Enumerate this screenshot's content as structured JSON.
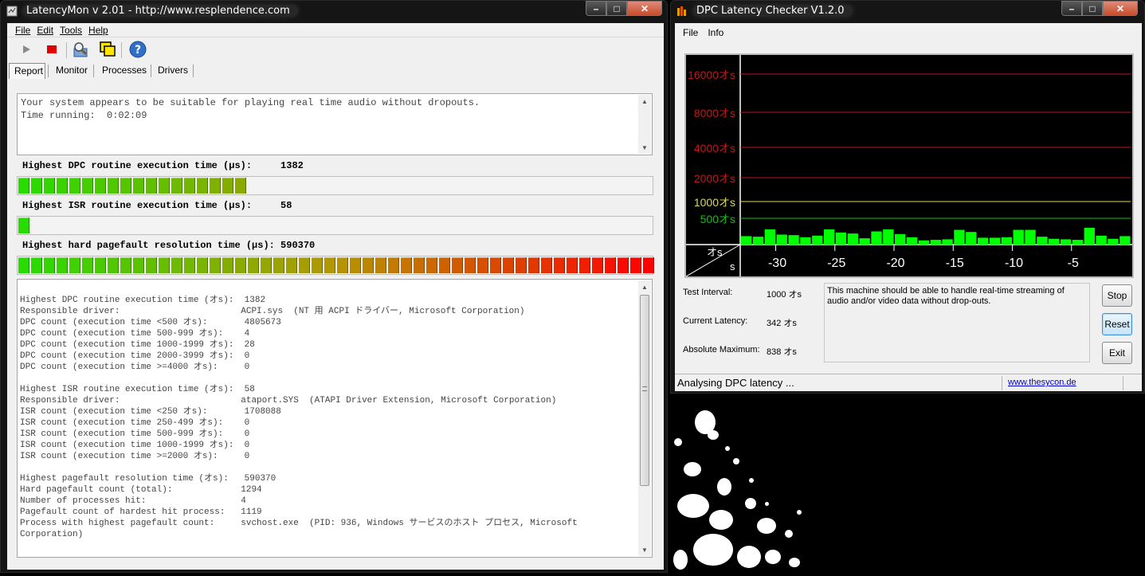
{
  "latencymon": {
    "title": "LatencyMon v 2.01 - http://www.resplendence.com",
    "menu": [
      "File",
      "Edit",
      "Tools",
      "Help"
    ],
    "tabs": [
      "Report",
      "Monitor",
      "Processes",
      "Drivers"
    ],
    "status_text": "Your system appears to be suitable for playing real time audio without dropouts.",
    "time_running": "Time running:  0:02:09",
    "dpc_label": "Highest DPC routine execution time (µs):     1382",
    "isr_label": "Highest ISR routine execution time (µs):     58",
    "pf_label": "Highest hard pagefault resolution time (µs): 590370",
    "dpc_level": 0.36,
    "isr_level": 0.02,
    "pf_level": 1.0,
    "report_lines": [
      "Highest DPC routine execution time (オs):  1382",
      "Responsible driver:                       ACPI.sys  (NT 用 ACPI ドライバー, Microsoft Corporation)",
      "DPC count (execution time <500 オs):       4805673",
      "DPC count (execution time 500-999 オs):    4",
      "DPC count (execution time 1000-1999 オs):  28",
      "DPC count (execution time 2000-3999 オs):  0",
      "DPC count (execution time >=4000 オs):     0",
      "",
      "Highest ISR routine execution time (オs):  58",
      "Responsible driver:                       ataport.SYS  (ATAPI Driver Extension, Microsoft Corporation)",
      "ISR count (execution time <250 オs):       1708088",
      "ISR count (execution time 250-499 オs):    0",
      "ISR count (execution time 500-999 オs):    0",
      "ISR count (execution time 1000-1999 オs):  0",
      "ISR count (execution time >=2000 オs):     0",
      "",
      "Highest pagefault resolution time (オs):   590370",
      "Hard pagefault count (total):             1294",
      "Number of processes hit:                  4",
      "Pagefault count of hardest hit process:   1119",
      "Process with highest pagefault count:     svchost.exe  (PID: 936, Windows サービスのホスト プロセス, Microsoft",
      "Corporation)"
    ]
  },
  "dpc_checker": {
    "title": "DPC Latency Checker V1.2.0",
    "menu": [
      "File",
      "Info"
    ],
    "test_interval_label": "Test Interval:",
    "test_interval_value": "1000 オs",
    "current_latency_label": "Current Latency:",
    "current_latency_value": "342 オs",
    "absolute_max_label": "Absolute Maximum:",
    "absolute_max_value": "838 オs",
    "message": "This machine should be able to handle real-time streaming of audio and/or video data without drop-outs.",
    "buttons": {
      "stop": "Stop",
      "reset": "Reset",
      "exit": "Exit"
    },
    "status": "Analysing DPC latency ...",
    "link": "www.thesycon.de",
    "colors": {
      "red_line": "#c01818",
      "yellow_line": "#d8d860",
      "green_line": "#10c010",
      "bar": "#00ff00"
    }
  },
  "chart_data": {
    "type": "bar",
    "title": "",
    "xlabel": "s",
    "ylabel": "オs",
    "y_ticks": [
      "16000オs",
      "8000オs",
      "4000オs",
      "2000オs",
      "1000オs",
      "500オs"
    ],
    "x_ticks": [
      "-30",
      "-25",
      "-20",
      "-15",
      "-10",
      "-5"
    ],
    "xlim": [
      -33,
      0
    ],
    "series": [
      {
        "values": [
          160,
          150,
          290,
          190,
          180,
          140,
          170,
          290,
          230,
          210,
          120,
          250,
          290,
          200,
          140,
          80,
          90,
          100,
          280,
          240,
          130,
          130,
          140,
          280,
          280,
          150,
          110,
          100,
          90,
          320,
          170,
          110,
          160
        ]
      }
    ]
  }
}
